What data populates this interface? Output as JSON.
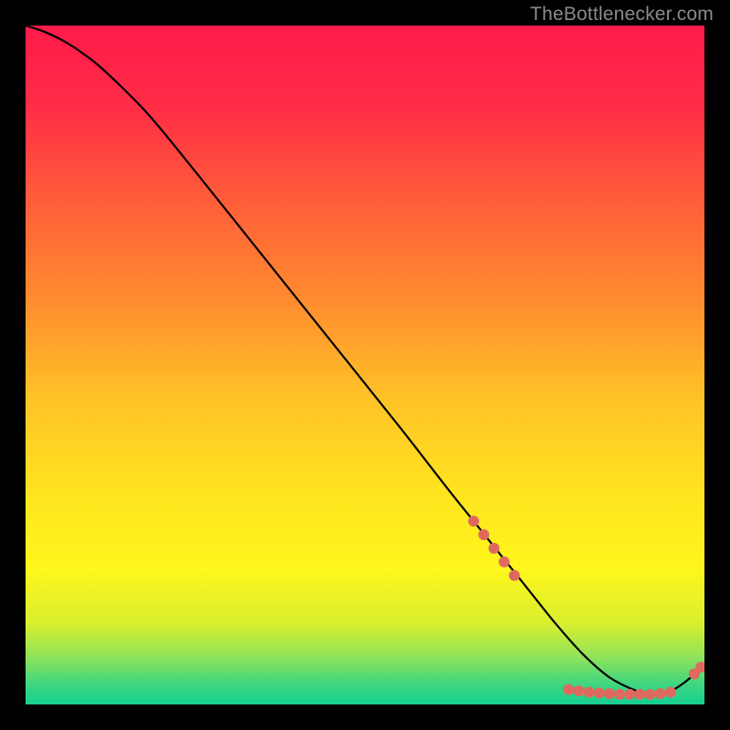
{
  "attribution": "TheBottlenecker.com",
  "chart_data": {
    "type": "line",
    "title": "",
    "xlabel": "",
    "ylabel": "",
    "xlim": [
      0,
      100
    ],
    "ylim": [
      0,
      100
    ],
    "legend": false,
    "grid": false,
    "background_gradient": {
      "stops": [
        {
          "offset": 0.0,
          "color": "#ff1a4b"
        },
        {
          "offset": 0.12,
          "color": "#ff2d46"
        },
        {
          "offset": 0.25,
          "color": "#ff5a3a"
        },
        {
          "offset": 0.4,
          "color": "#ff8a2f"
        },
        {
          "offset": 0.55,
          "color": "#ffc326"
        },
        {
          "offset": 0.7,
          "color": "#ffe61f"
        },
        {
          "offset": 0.8,
          "color": "#fff61c"
        },
        {
          "offset": 0.88,
          "color": "#d9ef2e"
        },
        {
          "offset": 0.93,
          "color": "#8fe35a"
        },
        {
          "offset": 0.97,
          "color": "#3fd680"
        },
        {
          "offset": 1.0,
          "color": "#15cf91"
        }
      ]
    },
    "series": [
      {
        "name": "bottleneck-curve",
        "color": "#000000",
        "x": [
          0.0,
          3.0,
          6.0,
          9.0,
          12.0,
          18.0,
          25.0,
          35.0,
          45.0,
          55.0,
          62.0,
          66.0,
          70.0,
          74.0,
          78.0,
          82.0,
          86.0,
          90.0,
          92.5,
          94.0,
          96.0,
          98.0,
          100.0
        ],
        "values": [
          100.0,
          99.0,
          97.5,
          95.5,
          93.0,
          87.0,
          78.5,
          66.0,
          53.5,
          41.0,
          32.0,
          27.0,
          22.0,
          17.0,
          12.0,
          7.5,
          4.0,
          2.0,
          1.5,
          1.5,
          2.5,
          4.0,
          6.0
        ]
      }
    ],
    "markers": {
      "name": "highlight-points",
      "color": "#e0695f",
      "radius_px": 6,
      "points": [
        {
          "x": 66.0,
          "y": 27.0
        },
        {
          "x": 67.5,
          "y": 25.0
        },
        {
          "x": 69.0,
          "y": 23.0
        },
        {
          "x": 70.5,
          "y": 21.0
        },
        {
          "x": 72.0,
          "y": 19.0
        },
        {
          "x": 80.0,
          "y": 2.2
        },
        {
          "x": 81.5,
          "y": 2.0
        },
        {
          "x": 83.0,
          "y": 1.8
        },
        {
          "x": 84.5,
          "y": 1.7
        },
        {
          "x": 86.0,
          "y": 1.6
        },
        {
          "x": 87.5,
          "y": 1.5
        },
        {
          "x": 89.0,
          "y": 1.5
        },
        {
          "x": 90.5,
          "y": 1.5
        },
        {
          "x": 92.0,
          "y": 1.5
        },
        {
          "x": 93.5,
          "y": 1.6
        },
        {
          "x": 95.0,
          "y": 1.8
        },
        {
          "x": 98.5,
          "y": 4.5
        },
        {
          "x": 99.5,
          "y": 5.5
        }
      ]
    }
  }
}
